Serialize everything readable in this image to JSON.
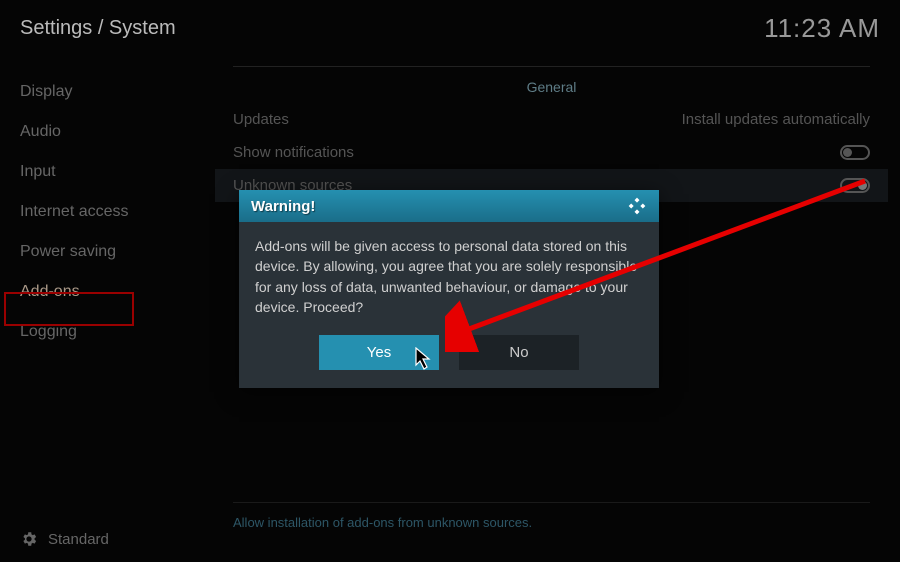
{
  "breadcrumb": "Settings / System",
  "clock": "11:23 AM",
  "sidebar": {
    "items": [
      {
        "label": "Display"
      },
      {
        "label": "Audio"
      },
      {
        "label": "Input"
      },
      {
        "label": "Internet access"
      },
      {
        "label": "Power saving"
      },
      {
        "label": "Add-ons"
      },
      {
        "label": "Logging"
      }
    ],
    "footer_label": "Standard"
  },
  "main": {
    "section_header": "General",
    "rows": [
      {
        "label": "Updates",
        "value": "Install updates automatically"
      },
      {
        "label": "Show notifications"
      },
      {
        "label": "Unknown sources"
      }
    ],
    "footer_hint": "Allow installation of add-ons from unknown sources."
  },
  "dialog": {
    "title": "Warning!",
    "body": "Add-ons will be given access to personal data stored on this device. By allowing, you agree that you are solely responsible for any loss of data, unwanted behaviour, or damage to your device. Proceed?",
    "yes_label": "Yes",
    "no_label": "No"
  }
}
